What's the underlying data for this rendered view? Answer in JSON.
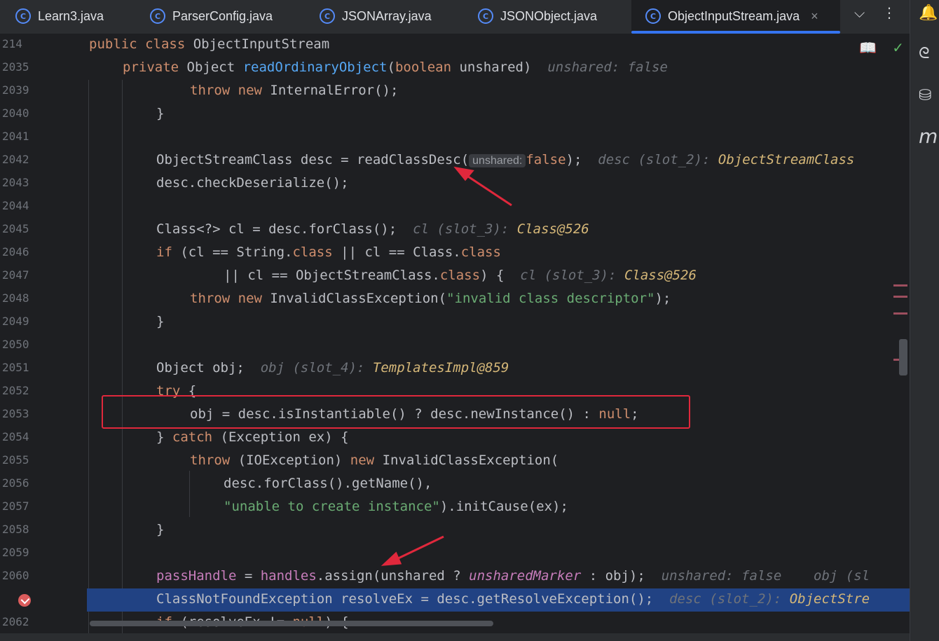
{
  "tabs": [
    {
      "label": "Learn3.java",
      "icon": "class-icon"
    },
    {
      "label": "ParserConfig.java",
      "icon": "class-icon"
    },
    {
      "label": "JSONArray.java",
      "icon": "class-icon"
    },
    {
      "label": "JSONObject.java",
      "icon": "class-icon"
    },
    {
      "label": "ObjectInputStream.java",
      "icon": "class-icon",
      "active": true
    }
  ],
  "tab_icon_letter": "C",
  "tab_close_glyph": "×",
  "tab_menu_glyph": "⌵",
  "tab_more_glyph": "⋮",
  "reader_glyph": "📖",
  "check_glyph": "✓",
  "sidebar_icons": [
    "bell-icon",
    "ai-assistant-icon",
    "database-icon",
    "maven-icon"
  ],
  "sidebar_glyphs": {
    "bell": "🔔",
    "ai": "ᘓ",
    "db": "⛁",
    "maven": "m"
  },
  "colors": {
    "accent": "#3574f0",
    "keyword": "#cf8e6d",
    "function": "#56a8f5",
    "string": "#6aab73",
    "highlight": "#214283",
    "annotation_red": "#e0283c"
  },
  "sticky": [
    {
      "num": "214",
      "text": "public class ObjectInputStream"
    },
    {
      "num": "2035",
      "text": "private Object readOrdinaryObject(boolean unshared)",
      "hint": "unshared: false"
    }
  ],
  "lines": {
    "l2039": {
      "num": "2039"
    },
    "l2040": {
      "num": "2040",
      "text": "}"
    },
    "l2041": {
      "num": "2041"
    },
    "l2042": {
      "num": "2042",
      "a": "ObjectStreamClass desc = ",
      "fn": "readClassDesc(",
      "chip": "unshared:",
      "b": "false",
      "c": ");",
      "hint": "desc (slot_2): ",
      "hintv": "ObjectStreamClass"
    },
    "l2043": {
      "num": "2043",
      "text": "desc.checkDeserialize();"
    },
    "l2044": {
      "num": "2044"
    },
    "l2045": {
      "num": "2045",
      "text": "Class<?> cl = desc.forClass();",
      "hint": "cl (slot_3): ",
      "hintv": "Class@526"
    },
    "l2046": {
      "num": "2046"
    },
    "l2047": {
      "num": "2047",
      "hint": "cl (slot_3): ",
      "hintv": "Class@526"
    },
    "l2048": {
      "num": "2048",
      "str": "\"invalid class descriptor\""
    },
    "l2049": {
      "num": "2049",
      "text": "}"
    },
    "l2050": {
      "num": "2050"
    },
    "l2051": {
      "num": "2051",
      "text": "Object obj;",
      "hint": "obj (slot_4): ",
      "hintv": "TemplatesImpl@859"
    },
    "l2052": {
      "num": "2052",
      "text": "try {"
    },
    "l2053": {
      "num": "2053"
    },
    "l2054": {
      "num": "2054"
    },
    "l2055": {
      "num": "2055"
    },
    "l2056": {
      "num": "2056",
      "text": "desc.forClass().getName(),"
    },
    "l2057": {
      "num": "2057",
      "str": "\"unable to create instance\"",
      "rest": ").initCause(ex);"
    },
    "l2058": {
      "num": "2058",
      "text": "}"
    },
    "l2059": {
      "num": "2059"
    },
    "l2060": {
      "num": "2060",
      "hint1": "unshared: false",
      "hint2": "obj (sl"
    },
    "l2061": {
      "num": "",
      "text": "ClassNotFoundException resolveEx = desc.getResolveException();",
      "hint": "desc (slot_2): ",
      "hintv": "ObjectStre"
    },
    "l2062": {
      "num": "2062",
      "text": "if (resolveEx != null) {"
    }
  }
}
